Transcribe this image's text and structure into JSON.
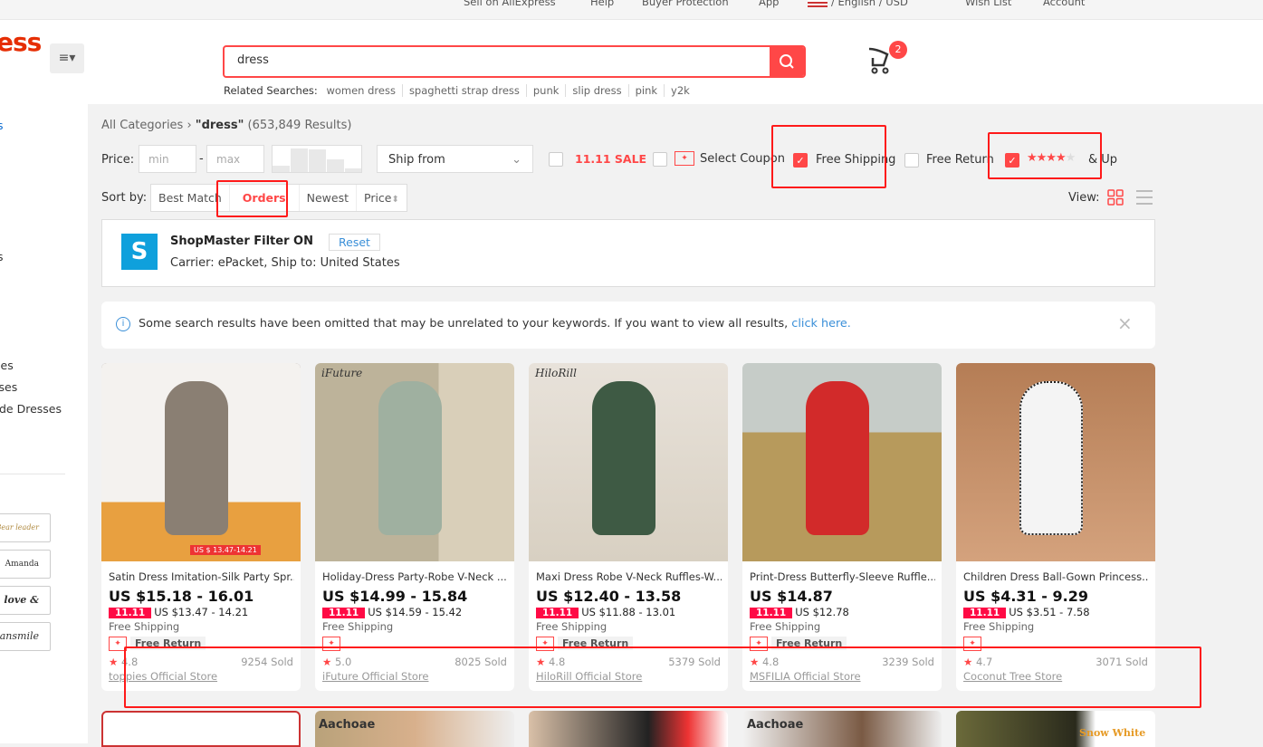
{
  "topbar": {
    "sell": "Sell on AliExpress",
    "help": "Help",
    "protection": "Buyer Protection",
    "app": "App",
    "lang": "/ English / USD",
    "wishlist": "Wish List",
    "account": "Account"
  },
  "header": {
    "logo": "ess",
    "search_value": "dress",
    "related_label": "Related Searches:",
    "related": [
      "women dress",
      "spaghetti strap dress",
      "punk",
      "slip dress",
      "pink",
      "y2k"
    ],
    "cart_count": "2"
  },
  "sidebar": {
    "items": [
      "s",
      "s",
      "ses",
      "sses",
      "de Dresses"
    ],
    "brands": [
      "Bear leader",
      "Amanda Chen",
      "love & bella",
      "ansmile"
    ]
  },
  "breadcrumb": {
    "root": "All Categories",
    "query": "\"dress\"",
    "count": "(653,849 Results)"
  },
  "filters": {
    "price_label": "Price:",
    "min_placeholder": "min",
    "max_placeholder": "max",
    "ship_from": "Ship from",
    "sale": "11.11 SALE",
    "select_coupon": "Select Coupon",
    "free_shipping": "Free Shipping",
    "free_shipping_checked": true,
    "free_return": "Free Return",
    "free_return_checked": false,
    "rating_checked": true,
    "rating_stars": 4,
    "and_up": "& Up"
  },
  "sort": {
    "label": "Sort by:",
    "options": [
      "Best Match",
      "Orders",
      "Newest",
      "Price"
    ],
    "active": "Orders",
    "view_label": "View:"
  },
  "shopmaster": {
    "title": "ShopMaster Filter ON",
    "reset": "Reset",
    "details": "Carrier: ePacket, Ship to: United States"
  },
  "notice": {
    "text": "Some search results have been omitted that may be unrelated to your keywords. If you want to view all results,",
    "link": "click here."
  },
  "products": [
    {
      "title": "Satin Dress Imitation-Silk Party Spr...",
      "price": "US $15.18 - 16.01",
      "sale_badge": "11.11",
      "sale_price": "US $13.47 - 14.21",
      "shipping": "Free Shipping",
      "free_return": "Free Return",
      "rating": "4.8",
      "sold": "9254 Sold",
      "store": "toppies Official Store",
      "banner": "US $ 13.47-14.21"
    },
    {
      "title": "Holiday-Dress Party-Robe V-Neck ...",
      "price": "US $14.99 - 15.84",
      "sale_badge": "11.11",
      "sale_price": "US $14.59 - 15.42",
      "shipping": "Free Shipping",
      "free_return": "",
      "rating": "5.0",
      "sold": "8025 Sold",
      "store": "iFuture Official Store",
      "brand": "iFuture"
    },
    {
      "title": "Maxi Dress Robe V-Neck Ruffles-W...",
      "price": "US $12.40 - 13.58",
      "sale_badge": "11.11",
      "sale_price": "US $11.88 - 13.01",
      "shipping": "Free Shipping",
      "free_return": "Free Return",
      "rating": "4.8",
      "sold": "5379 Sold",
      "store": "HiloRill Official Store",
      "brand": "HiloRill"
    },
    {
      "title": "Print-Dress Butterfly-Sleeve Ruffle...",
      "price": "US $14.87",
      "sale_badge": "11.11",
      "sale_price": "US $12.78",
      "shipping": "Free Shipping",
      "free_return": "Free Return",
      "rating": "4.8",
      "sold": "3239 Sold",
      "store": "MSFILIA Official Store"
    },
    {
      "title": "Children Dress Ball-Gown Princess...",
      "price": "US $4.31 - 9.29",
      "sale_badge": "11.11",
      "sale_price": "US $3.51 - 7.58",
      "shipping": "Free Shipping",
      "free_return": "",
      "rating": "4.7",
      "sold": "3071 Sold",
      "store": "Coconut Tree Store"
    }
  ],
  "row2_brands": [
    "Aachoae",
    "Aachoae",
    "Snow White"
  ],
  "colors": {
    "accent": "#ff4747",
    "sale": "#ff0a45",
    "shopmaster": "#0fa0dc"
  }
}
